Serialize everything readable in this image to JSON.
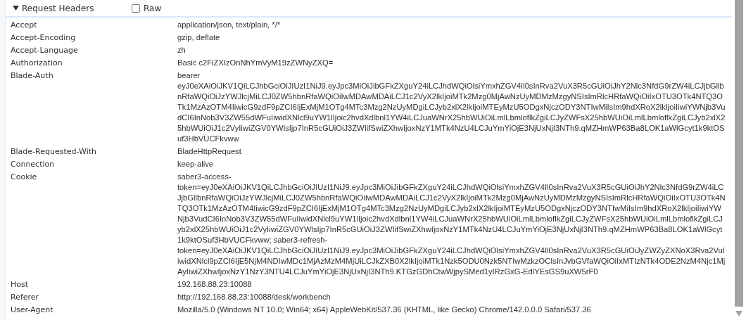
{
  "section": {
    "title": "Request Headers",
    "expanded": true,
    "raw": {
      "label": "Raw",
      "checked": false
    }
  },
  "headers": [
    {
      "name": "Accept",
      "value": "application/json, text/plain, */*"
    },
    {
      "name": "Accept-Encoding",
      "value": "gzip, deflate"
    },
    {
      "name": "Accept-Language",
      "value": "zh"
    },
    {
      "name": "Authorization",
      "value": "Basic c2FiZXIzOnNhYmVyM19zZWNyZXQ="
    },
    {
      "name": "Blade-Auth",
      "value": "bearer eyJ0eXAiOiJKV1QiLCJhbGciOiJIUzI1NiJ9.eyJpc3MiOiJibGFkZXguY24iLCJhdWQiOlsiYmxhZGV4Il0sInRva2VuX3R5cGUiOiJhY2Nlc3NfdG9rZW4iLCJjbGllbnRfaWQiOiJzYWJlcjMiLCJ0ZW5hbnRfaWQiOiIwMDAwMDAiLCJ1c2VyX2lkIjoiMTk2Mzg0MjAwNzUyMDMzMzgyNSIsImRlcHRfaWQiOiIxOTU3OTk4NTQ3OTk1MzAzOTM4IiwicG9zdF9pZCI6IjExMjM1OTg4MTc3Mzg2NzUyMDgiLCJyb2xlX2lkIjoiMTEyMzU5ODgxNjczODY3NTIwMiIsIm9hdXRoX2lkIjoiIiwiYWNjb3VudCI6InNob3V3ZW55dWFuIiwidXNlcl9uYW1lIjoic2hvdXdlbnl1YW4iLCJuaWNrX25hbWUiOiLmlLbmloflkZgiLCJyZWFsX25hbWUiOiLmlLbmloflkZgiLCJyb2xlX25hbWUiOiJ1c2VyIiwiZGV0YWlsIjp7InR5cGUiOiJ3ZWIifSwiZXhwIjoxNzY1MTk4NzU4LCJuYmYiOjE3NjUxNjI3NTh9.qMZHmWP63Ba8LOK1aWlGcyt1k9ktOSuf3HbVUCFkvww"
    },
    {
      "name": "Blade-Requested-With",
      "value": "BladeHttpRequest"
    },
    {
      "name": "Connection",
      "value": "keep-alive"
    },
    {
      "name": "Cookie",
      "value": "saber3-access-token=eyJ0eXAiOiJKV1QiLCJhbGciOiJIUzI1NiJ9.eyJpc3MiOiJibGFkZXguY24iLCJhdWQiOlsiYmxhZGV4Il0sInRva2VuX3R5cGUiOiJhY2Nlc3NfdG9rZW4iLCJjbGllbnRfaWQiOiJzYWJlcjMiLCJ0ZW5hbnRfaWQiOiIwMDAwMDAiLCJ1c2VyX2lkIjoiMTk2Mzg0MjAwNzUyMDMzMzgyNSIsImRlcHRfaWQiOiIxOTU3OTk4NTQ3OTk1MzAzOTM4IiwicG9zdF9pZCI6IjExMjM1OTg4MTc3Mzg2NzUyMDgiLCJyb2xlX2lkIjoiMTEyMzU5ODgxNjczODY3NTIwMiIsIm9hdXRoX2lkIjoiIiwiYWNjb3VudCI6InNob3V3ZW55dWFuIiwidXNlcl9uYW1lIjoic2hvdXdlbnl1YW4iLCJuaWNrX25hbWUiOiLmlLbmloflkZgiLCJyZWFsX25hbWUiOiLmlLbmloflkZgiLCJyb2xlX25hbWUiOiJ1c2VyIiwiZGV0YWlsIjp7InR5cGUiOiJ3ZWIifSwiZXhwIjoxNzY1MTk4NzU4LCJuYmYiOjE3NjUxNjI3NTh9.qMZHmWP63Ba8LOK1aWlGcyt1k9ktOSuf3HbVUCFkvww; saber3-refresh-token=eyJ0eXAiOiJKV1QiLCJhbGciOiJIUzI1NiJ9.eyJpc3MiOiJibGFkZXguY24iLCJhdWQiOlsiYmxhZGV4Il0sInRva2VuX3R5cGUiOiJyZWZyZXNoX3Rva2VuIiwidXNlcl9pZCI6IjE5NjM4NDIwMDc1MjAzMzM4MjUiLCJkZXB0X2lkIjoiMTk1Nzk5ODU0Nzk5NTIwMzkzOCIsInJvbGVfaWQiOiIxMTIzNTk4ODE2NzM4Njc1MjAyIiwiZXhwIjoxNzY1NzY3NTU4LCJuYmYiOjE3NjUxNjI3NTh9.KTGzGDhCtwWjpySMed1yIRzGxG-EdlYEsGS9uXW5rF0"
    },
    {
      "name": "Host",
      "value": "192.168.88.23:10088"
    },
    {
      "name": "Referer",
      "value": "http://192.168.88.23:10088/desk/workbench"
    },
    {
      "name": "User-Agent",
      "value": "Mozilla/5.0 (Windows NT 10.0; Win64; x64) AppleWebKit/537.36 (KHTML, like Gecko) Chrome/142.0.0.0 Safari/537.36"
    }
  ]
}
